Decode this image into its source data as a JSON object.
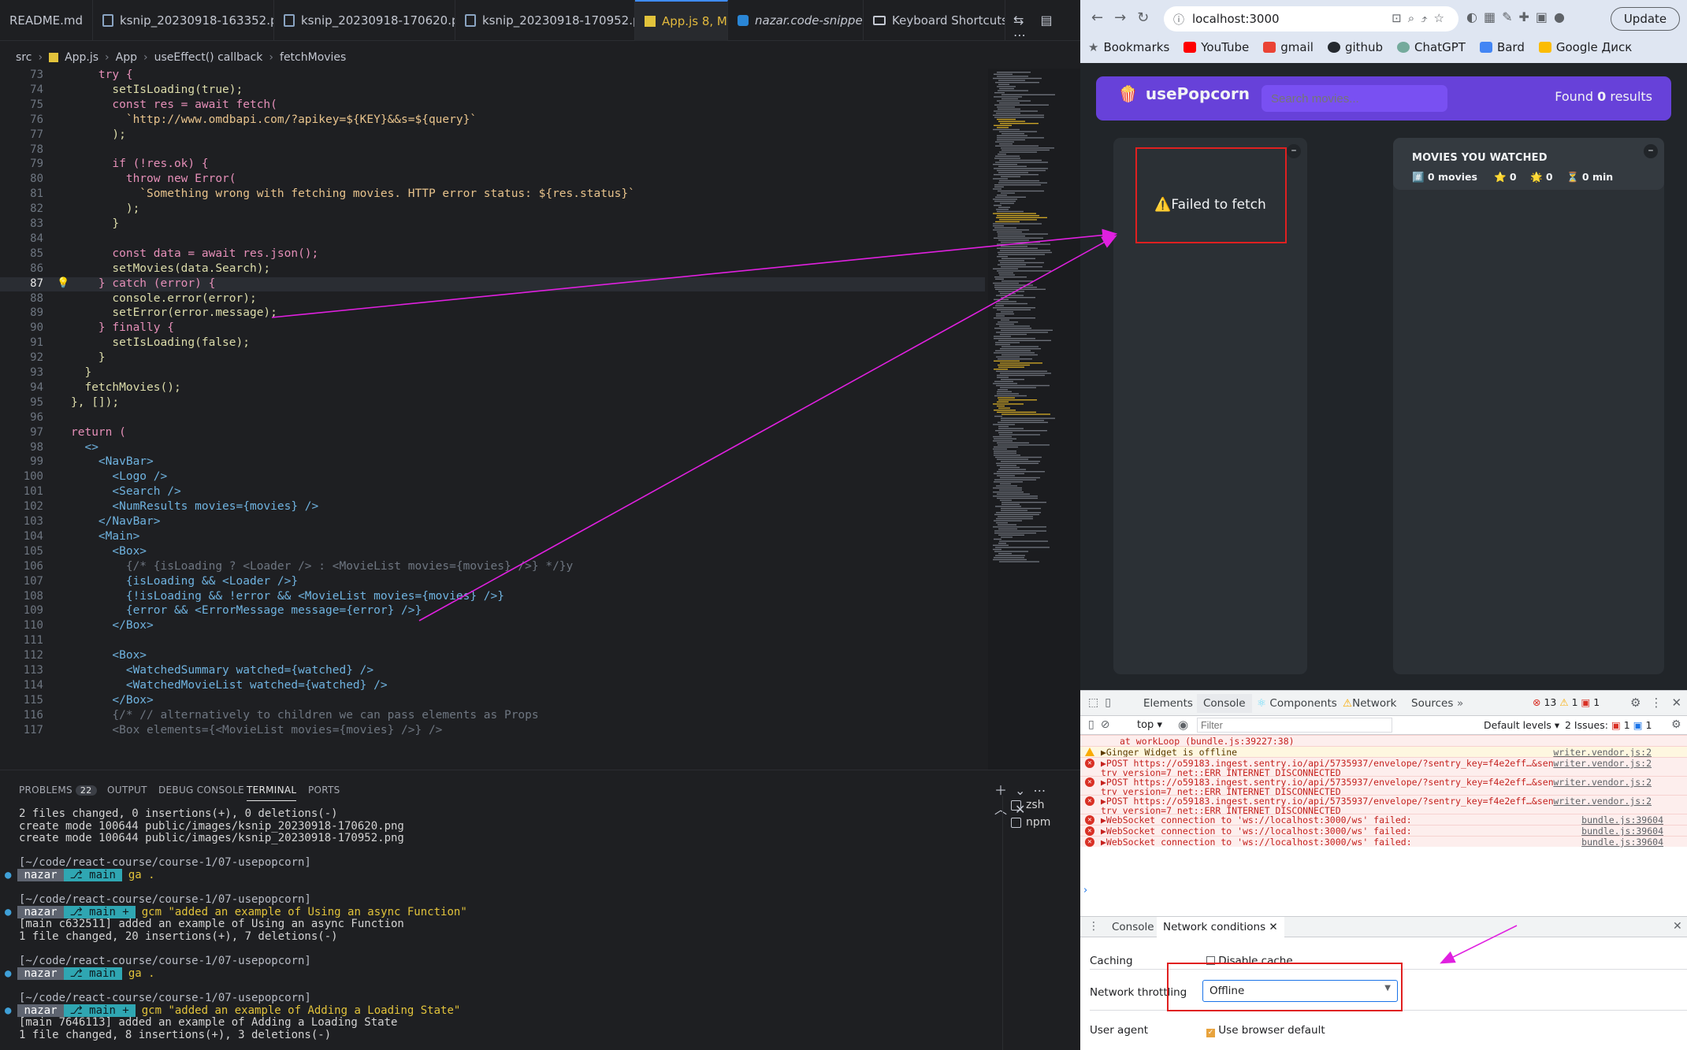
{
  "editor": {
    "tabs": [
      "README.md",
      "ksnip_20230918-163352.png",
      "ksnip_20230918-170620.png",
      "ksnip_20230918-170952.png",
      "App.js 8, M",
      "nazar.code-snippets",
      "Keyboard Shortcuts"
    ],
    "breadcrumb": [
      "src",
      "App.js",
      "App",
      "useEffect() callback",
      "fetchMovies"
    ],
    "lines": [
      {
        "n": "73",
        "code": "    try {"
      },
      {
        "n": "74",
        "code": "      setIsLoading(true);"
      },
      {
        "n": "75",
        "code": "      const res = await fetch("
      },
      {
        "n": "76",
        "code": "        `http://www.omdbapi.com/?apikey=${KEY}&&s=${query}`"
      },
      {
        "n": "77",
        "code": "      );"
      },
      {
        "n": "78",
        "code": ""
      },
      {
        "n": "79",
        "code": "      if (!res.ok) {"
      },
      {
        "n": "80",
        "code": "        throw new Error("
      },
      {
        "n": "81",
        "code": "          `Something wrong with fetching movies. HTTP error status: ${res.status}`"
      },
      {
        "n": "82",
        "code": "        );"
      },
      {
        "n": "83",
        "code": "      }"
      },
      {
        "n": "84",
        "code": ""
      },
      {
        "n": "85",
        "code": "      const data = await res.json();"
      },
      {
        "n": "86",
        "code": "      setMovies(data.Search);"
      },
      {
        "n": "87",
        "code": "    } catch (error) {"
      },
      {
        "n": "88",
        "code": "      console.error(error);"
      },
      {
        "n": "89",
        "code": "      setError(error.message);"
      },
      {
        "n": "90",
        "code": "    } finally {"
      },
      {
        "n": "91",
        "code": "      setIsLoading(false);"
      },
      {
        "n": "92",
        "code": "    }"
      },
      {
        "n": "93",
        "code": "  }"
      },
      {
        "n": "94",
        "code": "  fetchMovies();"
      },
      {
        "n": "95",
        "code": "}, []);"
      },
      {
        "n": "96",
        "code": ""
      },
      {
        "n": "97",
        "code": "return ("
      },
      {
        "n": "98",
        "code": "  <>"
      },
      {
        "n": "99",
        "code": "    <NavBar>"
      },
      {
        "n": "100",
        "code": "      <Logo />"
      },
      {
        "n": "101",
        "code": "      <Search />"
      },
      {
        "n": "102",
        "code": "      <NumResults movies={movies} />"
      },
      {
        "n": "103",
        "code": "    </NavBar>"
      },
      {
        "n": "104",
        "code": "    <Main>"
      },
      {
        "n": "105",
        "code": "      <Box>"
      },
      {
        "n": "106",
        "code": "        {/* {isLoading ? <Loader /> : <MovieList movies={movies} />} */}y"
      },
      {
        "n": "107",
        "code": "        {isLoading && <Loader />}"
      },
      {
        "n": "108",
        "code": "        {!isLoading && !error && <MovieList movies={movies} />}"
      },
      {
        "n": "109",
        "code": "        {error && <ErrorMessage message={error} />}"
      },
      {
        "n": "110",
        "code": "      </Box>"
      },
      {
        "n": "111",
        "code": ""
      },
      {
        "n": "112",
        "code": "      <Box>"
      },
      {
        "n": "113",
        "code": "        <WatchedSummary watched={watched} />"
      },
      {
        "n": "114",
        "code": "        <WatchedMovieList watched={watched} />"
      },
      {
        "n": "115",
        "code": "      </Box>"
      },
      {
        "n": "116",
        "code": "      {/* // alternatively to children we can pass elements as Props"
      },
      {
        "n": "117",
        "code": "      <Box elements={<MovieList movies={movies} />} />"
      }
    ]
  },
  "panel": {
    "tabs": [
      "PROBLEMS",
      "OUTPUT",
      "DEBUG CONSOLE",
      "TERMINAL",
      "PORTS"
    ],
    "problems_count": "22",
    "sessions": [
      "zsh",
      "npm"
    ],
    "terminal": [
      "2 files changed, 0 insertions(+), 0 deletions(-)",
      "create mode 100644 public/images/ksnip_20230918-170620.png",
      "create mode 100644 public/images/ksnip_20230918-170952.png",
      "",
      "[~/code/react-course/course-1/07-usepopcorn]",
      "PROMPT|nazar|main|ga .",
      "",
      "[~/code/react-course/course-1/07-usepopcorn]",
      "PROMPT|nazar|main +|gcm \"added an example of Using an async Function\"",
      "[main c632511] added an example of Using an async Function",
      "1 file changed, 20 insertions(+), 7 deletions(-)",
      "",
      "[~/code/react-course/course-1/07-usepopcorn]",
      "PROMPT|nazar|main|ga .",
      "",
      "[~/code/react-course/course-1/07-usepopcorn]",
      "PROMPT|nazar|main +|gcm \"added an example of Adding a Loading State\"",
      "[main 7646113] added an example of Adding a Loading State",
      "1 file changed, 8 insertions(+), 3 deletions(-)"
    ]
  },
  "browser": {
    "url": "localhost:3000",
    "update_label": "Update",
    "bookmarks": [
      "Bookmarks",
      "YouTube",
      "gmail",
      "github",
      "ChatGPT",
      "Bard",
      "Google Диск"
    ],
    "app": {
      "logo": "usePopcorn",
      "logo_icon": "🍿",
      "search_placeholder": "Search movies...",
      "found_prefix": "Found",
      "found_count": "0",
      "found_suffix": "results",
      "error_message": "⚠️Failed to fetch",
      "toggle": "–",
      "watched_title": "MOVIES YOU WATCHED",
      "stats": [
        "#️⃣ 0 movies",
        "⭐️ 0",
        "🌟 0",
        "⏳ 0 min"
      ]
    },
    "devtools": {
      "tabs": [
        "Elements",
        "Console",
        "Components",
        "Network",
        "Sources"
      ],
      "counts": [
        "13",
        "1",
        "1"
      ],
      "context": "top",
      "filter_placeholder": "Filter",
      "levels": "Default levels",
      "issues": "2 Issues: ",
      "issues_counts": [
        "1",
        "1"
      ],
      "log": [
        {
          "type": "trace",
          "text": "at workLoop (bundle.js:39227:38)"
        },
        {
          "type": "warn",
          "text": "▶Ginger Widget is offline",
          "src": "writer.vendor.js:2"
        },
        {
          "type": "error",
          "text": "▶POST https://o59183.ingest.sentry.io/api/5735937/envelope/?sentry_key=f4e2eff…&sen",
          "text2": "try_version=7 net::ERR_INTERNET_DISCONNECTED",
          "src": "writer.vendor.js:2"
        },
        {
          "type": "error",
          "text": "▶POST https://o59183.ingest.sentry.io/api/5735937/envelope/?sentry_key=f4e2eff…&sen",
          "text2": "try_version=7 net::ERR_INTERNET_DISCONNECTED",
          "src": "writer.vendor.js:2"
        },
        {
          "type": "error",
          "text": "▶POST https://o59183.ingest.sentry.io/api/5735937/envelope/?sentry_key=f4e2eff…&sen",
          "text2": "try_version=7 net::ERR_INTERNET_DISCONNECTED",
          "src": "writer.vendor.js:2"
        },
        {
          "type": "error",
          "text": "▶WebSocket connection to 'ws://localhost:3000/ws' failed:",
          "src": "bundle.js:39604"
        },
        {
          "type": "error",
          "text": "▶WebSocket connection to 'ws://localhost:3000/ws' failed:",
          "src": "bundle.js:39604"
        },
        {
          "type": "error",
          "text": "▶WebSocket connection to 'ws://localhost:3000/ws' failed:",
          "src": "bundle.js:39604"
        }
      ],
      "drawer_tabs": [
        "Console",
        "Network conditions"
      ],
      "caching_label": "Caching",
      "disable_cache": "Disable cache",
      "throttling_label": "Network throttling",
      "throttling_value": "Offline",
      "user_agent_label": "User agent",
      "use_default": "Use browser default"
    }
  },
  "colors": {
    "accent": "#6741d9",
    "annotation": "#e02020",
    "arrow": "#e020e0"
  }
}
